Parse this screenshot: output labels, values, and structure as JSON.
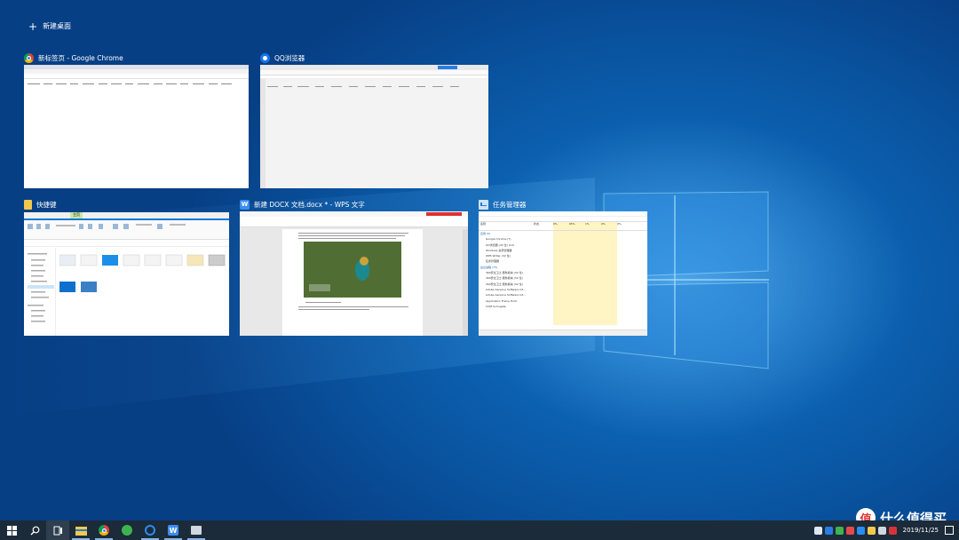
{
  "new_desktop": {
    "label": "新建桌面"
  },
  "windows": [
    {
      "title": "新标签页 - Google Chrome",
      "icon": "chrome-icon"
    },
    {
      "title": "QQ浏览器",
      "icon": "qq-browser-icon"
    },
    {
      "title": "快捷键",
      "icon": "folder-icon"
    },
    {
      "title": "新建 DOCX 文档.docx * - WPS 文字",
      "icon": "wps-writer-icon"
    },
    {
      "title": "任务管理器",
      "icon": "task-manager-icon"
    }
  ],
  "task_manager": {
    "headers": [
      "名称",
      "状态",
      "6%",
      "65%",
      "1%",
      "0%",
      "0%"
    ],
    "apps_section": "应用 (5)",
    "apps": [
      "Google Chrome (7)",
      "QQ浏览器 (32 位) (10)",
      "Windows 资源管理器",
      "WPS Writer (32 位)",
      "任务管理器"
    ],
    "bg_section": "后台进程 (75)",
    "bg": [
      "360安全卫士 服务模块 (32 位)",
      "360安全卫士 服务模块 (32 位)",
      "360安全卫士 服务模块 (32 位)",
      "Adobe Genuine Software Int...",
      "Adobe Genuine Software Int...",
      "Application Frame Host",
      "COM Surrogate"
    ]
  },
  "explorer": {
    "tab": "主页",
    "files": [
      "5.png",
      "6.png",
      "7.png",
      "8.png",
      "9.png",
      "10.png",
      "11.png",
      "12.png",
      "13.png",
      "14.png"
    ],
    "folders": [
      "快速访问",
      "桌面",
      "下载",
      "文档",
      "图片",
      "此电脑",
      "网络"
    ]
  },
  "taskbar": {
    "items": [
      "start-icon",
      "search-icon",
      "task-view-icon",
      "file-explorer-icon",
      "chrome-icon",
      "360-icon",
      "qq-browser-icon",
      "wps-icon",
      "task-manager-icon"
    ],
    "time": "",
    "date": "2019/11/25"
  },
  "watermark": {
    "logo": "值",
    "text": "什么值得买"
  },
  "colors": {
    "accent": "#0a5aa8",
    "taskbar": "#1c2b3a",
    "selection": "#0078d7"
  }
}
